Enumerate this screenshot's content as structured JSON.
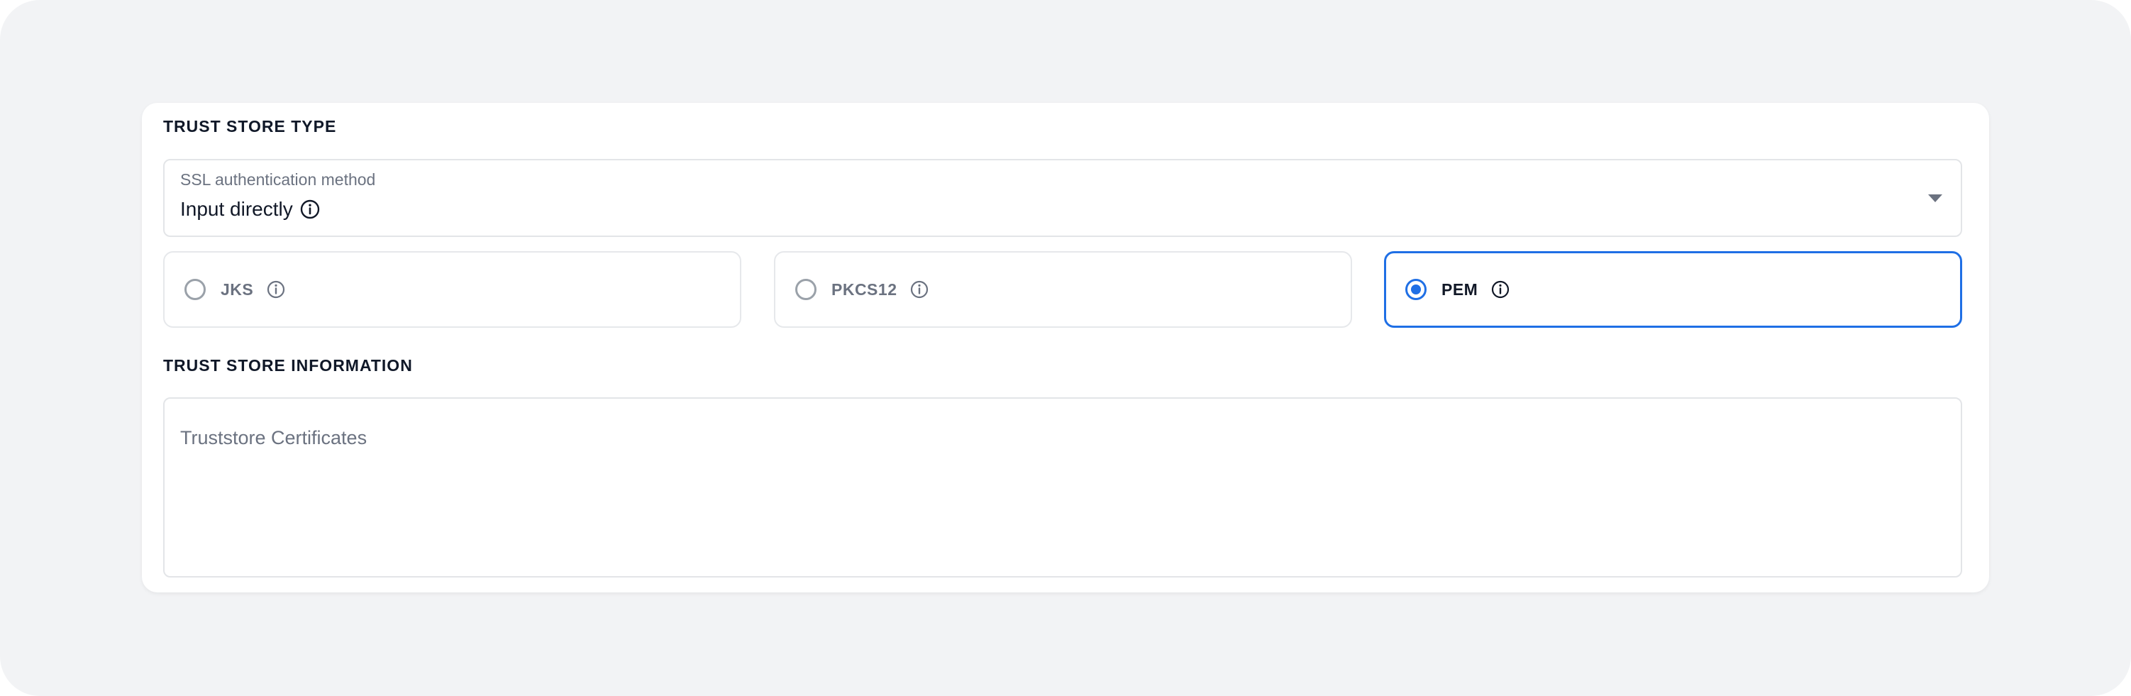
{
  "trust_store_type": {
    "title": "TRUST STORE TYPE",
    "select": {
      "label": "SSL authentication method",
      "value": "Input directly",
      "info_icon": "info-icon",
      "caret_icon": "chevron-down-icon"
    },
    "options": [
      {
        "label": "JKS",
        "selected": false,
        "info_icon": "info-icon"
      },
      {
        "label": "PKCS12",
        "selected": false,
        "info_icon": "info-icon"
      },
      {
        "label": "PEM",
        "selected": true,
        "info_icon": "info-icon"
      }
    ]
  },
  "trust_store_information": {
    "title": "TRUST STORE INFORMATION",
    "certificates_placeholder": "Truststore Certificates"
  },
  "colors": {
    "accent": "#1f6fe5",
    "background": "#f2f3f5",
    "card": "#ffffff",
    "muted_text": "#6b7280"
  }
}
